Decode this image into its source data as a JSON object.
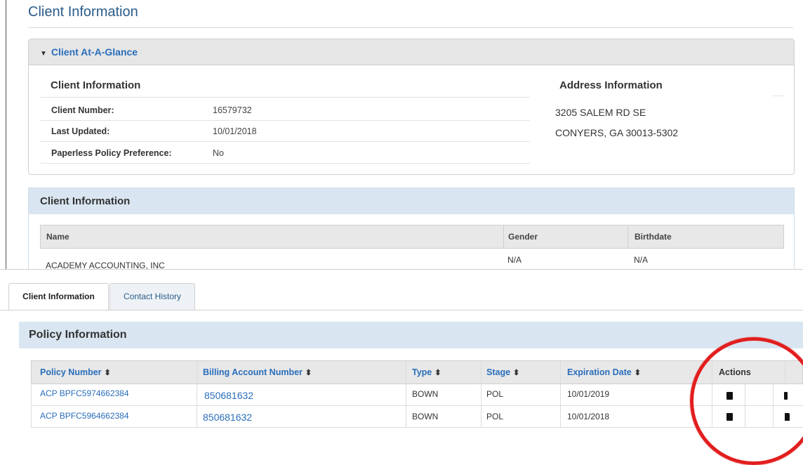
{
  "page": {
    "title": "Client Information"
  },
  "glance": {
    "toggle_label": "Client At-A-Glance",
    "client_info": {
      "title": "Client Information",
      "rows": [
        {
          "label": "Client Number:",
          "value": "16579732"
        },
        {
          "label": "Last Updated:",
          "value": "10/01/2018"
        },
        {
          "label": "Paperless Policy Preference:",
          "value": "No"
        }
      ]
    },
    "address": {
      "title": "Address Information",
      "line1": "3205 SALEM RD SE",
      "line2": "CONYERS, GA 30013-5302"
    }
  },
  "client_panel": {
    "title": "Client Information",
    "columns": [
      "Name",
      "Gender",
      "Birthdate"
    ],
    "row": {
      "name": "ACADEMY ACCOUNTING, INC",
      "gender": "N/A",
      "birthdate": "N/A"
    }
  },
  "tabs": [
    {
      "label": "Client Information",
      "active": true
    },
    {
      "label": "Contact History",
      "active": false
    }
  ],
  "policy_panel": {
    "title": "Policy Information",
    "columns": {
      "policy_number": "Policy Number",
      "billing_account": "Billing Account Number",
      "type": "Type",
      "stage": "Stage",
      "expiration": "Expiration Date",
      "actions": "Actions"
    },
    "sort_glyph": "⬍",
    "rows": [
      {
        "policy_number": "ACP BPFC5974662384",
        "billing_account": "850681632",
        "type": "BOWN",
        "stage": "POL",
        "expiration": "10/01/2019"
      },
      {
        "policy_number": "ACP BPFC5964662384",
        "billing_account": "850681632",
        "type": "BOWN",
        "stage": "POL",
        "expiration": "10/01/2018"
      }
    ]
  },
  "colors": {
    "link": "#2a6ebb",
    "panel_blue": "#d9e6f1",
    "highlight_circle": "#e21e1e"
  }
}
